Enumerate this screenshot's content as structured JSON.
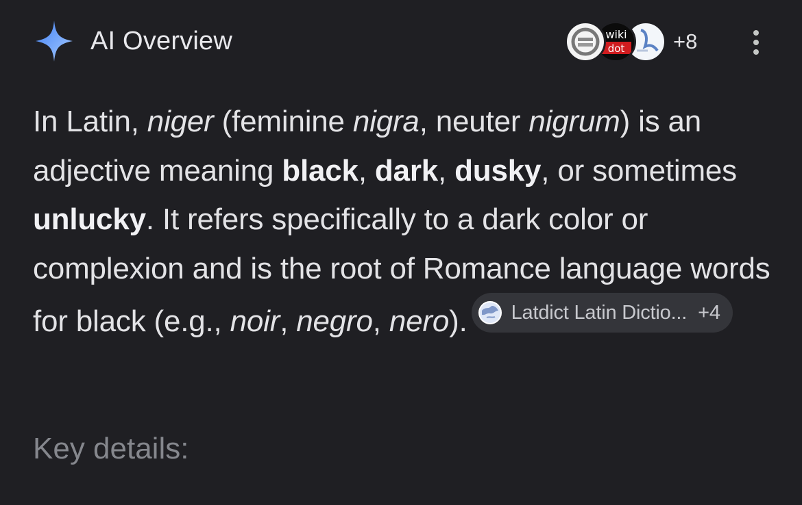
{
  "header": {
    "title": "AI Overview",
    "sources_more": "+8",
    "source_logo_text": "wiki dot"
  },
  "overview": {
    "parts": [
      "In Latin, ",
      "niger",
      " (feminine ",
      "nigra",
      ", neuter ",
      "nigrum",
      ") is an adjective meaning ",
      "black",
      ", ",
      "dark",
      ", ",
      "dusky",
      ", or sometimes ",
      "unlucky",
      ". It refers specifically to a dark color or complexion and is the root of Romance language words for black (e.g., ",
      "noir",
      ", ",
      "negro",
      ", ",
      "nero",
      ")."
    ]
  },
  "citation": {
    "label": "Latdict Latin Dictio...",
    "count": "+4"
  },
  "key_details_label": "Key details:",
  "colors": {
    "background": "#1f1f23",
    "text": "#e3e3e6",
    "muted": "#85878d",
    "chip": "#34353a",
    "sparkle_start": "#4f8cf7",
    "sparkle_end": "#9fc4ff"
  },
  "icons": [
    "sparkle-icon",
    "globe-icon",
    "more-vert-icon"
  ]
}
